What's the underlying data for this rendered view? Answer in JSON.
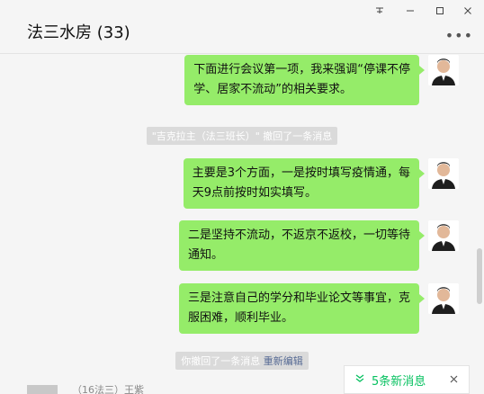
{
  "window": {
    "pin_icon": "pin-icon",
    "minimize_icon": "minimize-icon",
    "maximize_icon": "maximize-icon",
    "close_icon": "close-icon"
  },
  "header": {
    "title": "法三水房 (33)",
    "more_icon": "more-icon"
  },
  "messages": [
    {
      "type": "outgoing",
      "lines": [
        "下面进行会议第一项，我来强调“停课不停",
        "学、居家不流动”的相关要求。"
      ]
    },
    {
      "type": "system",
      "text": "\"吉克拉主（法三班长）\" 撤回了一条消息"
    },
    {
      "type": "outgoing",
      "lines": [
        "主要是3个方面，一是按时填写疫情通，每",
        "天9点前按时如实填写。"
      ]
    },
    {
      "type": "outgoing",
      "lines": [
        "二是坚持不流动，不返京不返校，一切等待",
        "通知。"
      ]
    },
    {
      "type": "outgoing",
      "lines": [
        "三是注意自己的学分和毕业论文等事宜，克",
        "服困难，顺利毕业。"
      ]
    }
  ],
  "recall": {
    "text": "你撤回了一条消息",
    "link": "重新编辑"
  },
  "next_sender": "（16法三）王紫",
  "new_messages": {
    "label": "5条新消息"
  },
  "colors": {
    "bubble": "#95ec69",
    "accent": "#07c160",
    "link": "#576b95"
  }
}
